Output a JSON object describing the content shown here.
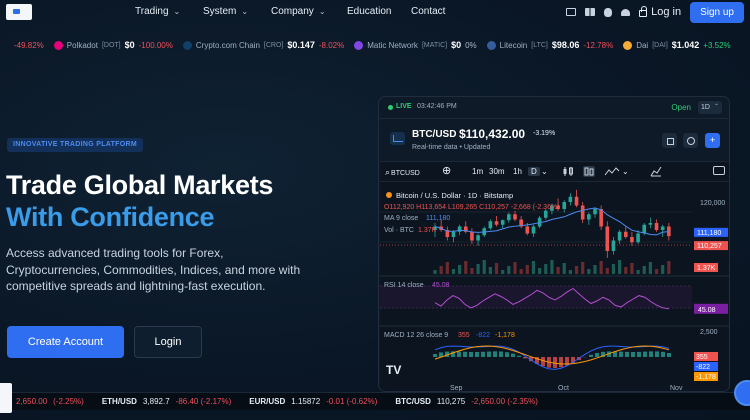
{
  "nav": {
    "items": [
      {
        "label": "Trading",
        "has_menu": true
      },
      {
        "label": "System",
        "has_menu": true
      },
      {
        "label": "Company",
        "has_menu": true
      },
      {
        "label": "Education",
        "has_menu": false
      },
      {
        "label": "Contact",
        "has_menu": false
      }
    ],
    "login": "Log in",
    "signup": "Sign up",
    "platforms": [
      "desktop-icon",
      "windows-icon",
      "apple-icon",
      "android-icon"
    ]
  },
  "ticker_top": [
    {
      "name": "",
      "symbol": "",
      "price": "",
      "change": "-49.82%",
      "dir": "neg",
      "color": "#e04545"
    },
    {
      "name": "Polkadot",
      "symbol": "[DOT]",
      "price": "$0",
      "change": "-100.00%",
      "dir": "neg",
      "color": "#e6007a"
    },
    {
      "name": "Crypto.com Chain",
      "symbol": "[CRO]",
      "price": "$0.147",
      "change": "-8.02%",
      "dir": "neg",
      "color": "#103f68"
    },
    {
      "name": "Matic Network",
      "symbol": "[MATIC]",
      "price": "$0",
      "change": "0%",
      "dir": "grey",
      "color": "#8247e5"
    },
    {
      "name": "Litecoin",
      "symbol": "[LTC]",
      "price": "$98.06",
      "change": "-12.78%",
      "dir": "neg",
      "color": "#345d9d"
    },
    {
      "name": "Dai",
      "symbol": "[DAI]",
      "price": "$1.042",
      "change": "+3.52%",
      "dir": "pos",
      "color": "#f5ac37"
    }
  ],
  "hero": {
    "badge": "INNOVATIVE TRADING PLATFORM",
    "title_line1": "Trade Global Markets",
    "title_line2": "With Confidence",
    "lead": "Access advanced trading tools for Forex, Cryptocurrencies, Commodities, Indices, and more with competitive spreads and lightning-fast execution.",
    "primary_cta": "Create Account",
    "secondary_cta": "Login"
  },
  "card": {
    "live": "LIVE",
    "time": "03:42:46 PM",
    "status": "Open",
    "timeframe": "1D",
    "symbol": "BTC/USD",
    "price": "$110,432.00",
    "change": "-3.19%",
    "sub_left": "Real-time data",
    "sub_right": "Updated"
  },
  "chart_toolbar": {
    "search": "BTCUSD",
    "intervals": [
      "1m",
      "30m",
      "1h",
      "D"
    ],
    "selected": "D"
  },
  "chart_data": {
    "type": "candlestick",
    "title": "Bitcoin / U.S. Dollar · 1D · Bitstamp",
    "ohlc_label": {
      "o": "O112,920",
      "h": "H113,654",
      "l": "L109,265",
      "c": "C110,257",
      "chg": "-2,668 (-2.36%)"
    },
    "ma_label": "MA 9 close",
    "ma_value": "111,180",
    "vol_label": "Vol · BTC",
    "vol_value": "1.37K",
    "price_axis": [
      "120,000",
      "111,180",
      "110,257"
    ],
    "price_ylim": [
      100000,
      124000
    ],
    "rsi": {
      "label": "RSI 14 close",
      "value": "45.08",
      "axis_value": "45.08",
      "values": [
        52,
        48,
        55,
        60,
        57,
        50,
        46,
        49,
        54,
        58,
        62,
        59,
        55,
        50,
        53,
        57,
        61,
        66,
        63,
        58,
        55,
        59,
        64,
        68,
        62,
        56,
        51,
        54,
        58,
        55,
        49,
        47,
        52,
        56,
        60,
        58,
        53,
        49,
        46,
        45
      ]
    },
    "macd": {
      "label": "MACD 12 26 close 9",
      "v1": "355",
      "v2": "-822",
      "v3": "-1,178",
      "axis_top": "2,500",
      "axis_values": [
        "355",
        "-822",
        "-1,178"
      ]
    },
    "x_labels": [
      "Sep",
      "Oct",
      "Nov"
    ],
    "candles": [
      [
        112000,
        114000,
        110000,
        113000
      ],
      [
        113000,
        115000,
        111500,
        112000
      ],
      [
        112000,
        113000,
        109000,
        110000
      ],
      [
        110000,
        112000,
        108500,
        111500
      ],
      [
        111500,
        113500,
        110500,
        113000
      ],
      [
        113000,
        114500,
        111000,
        111500
      ],
      [
        111500,
        112500,
        108000,
        109000
      ],
      [
        109000,
        111000,
        107500,
        110500
      ],
      [
        110500,
        113000,
        110000,
        112500
      ],
      [
        112500,
        115000,
        112000,
        114500
      ],
      [
        114500,
        116000,
        113000,
        113500
      ],
      [
        113500,
        115000,
        112500,
        114800
      ],
      [
        114800,
        117000,
        114000,
        116500
      ],
      [
        116500,
        117500,
        114500,
        115000
      ],
      [
        115000,
        116000,
        112500,
        113000
      ],
      [
        113000,
        114000,
        110500,
        111000
      ],
      [
        111000,
        113500,
        110000,
        113000
      ],
      [
        113000,
        116000,
        112500,
        115500
      ],
      [
        115500,
        118000,
        115000,
        117500
      ],
      [
        117500,
        119500,
        116500,
        119000
      ],
      [
        119000,
        121000,
        117500,
        118000
      ],
      [
        118000,
        120500,
        117000,
        120000
      ],
      [
        120000,
        122500,
        119000,
        121500
      ],
      [
        121500,
        123500,
        118500,
        119000
      ],
      [
        119000,
        120000,
        114000,
        115000
      ],
      [
        115000,
        117000,
        113500,
        116500
      ],
      [
        116500,
        118500,
        115500,
        118000
      ],
      [
        118000,
        119000,
        112000,
        113000
      ],
      [
        113000,
        114500,
        104000,
        106000
      ],
      [
        106000,
        110000,
        105000,
        109000
      ],
      [
        109000,
        112000,
        108000,
        111500
      ],
      [
        111500,
        113000,
        109500,
        110000
      ],
      [
        110000,
        111500,
        107500,
        108500
      ],
      [
        108500,
        112000,
        108000,
        111000
      ],
      [
        111000,
        114000,
        110500,
        113500
      ],
      [
        113500,
        115500,
        112500,
        114000
      ],
      [
        114000,
        115000,
        111500,
        112000
      ],
      [
        112000,
        113500,
        110000,
        113000
      ],
      [
        113000,
        114000,
        109000,
        110257
      ]
    ],
    "colors": {
      "up": "#26a69a",
      "down": "#ef5350",
      "ma": "#4d8cf0",
      "rsi": "#9c27b0"
    }
  },
  "ticker_bottom": [
    {
      "name": "",
      "price": "2,650.00",
      "change": "(-2.25%)",
      "dir": "neg"
    },
    {
      "name": "ETH/USD",
      "price": "3,892.7",
      "change": "-86.40 (-2.17%)",
      "dir": "neg"
    },
    {
      "name": "EUR/USD",
      "price": "1.15872",
      "change": "-0.01 (-0.62%)",
      "dir": "neg"
    },
    {
      "name": "BTC/USD",
      "price": "110,275",
      "change": "-2,650.00 (-2.35%)",
      "dir": "neg"
    }
  ]
}
